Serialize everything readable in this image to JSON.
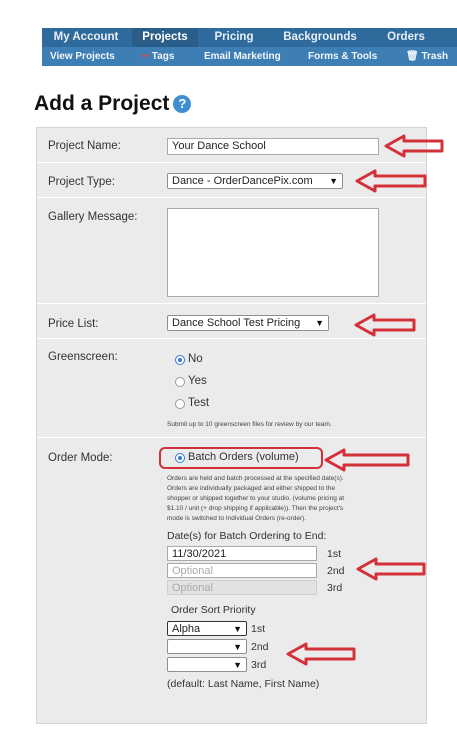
{
  "nav": {
    "tabs": [
      "My Account",
      "Projects",
      "Pricing",
      "Backgrounds",
      "Orders"
    ],
    "active_tab": "Projects",
    "subnav": [
      "View Projects",
      "Tags",
      "Email Marketing",
      "Forms & Tools",
      "Trash"
    ]
  },
  "page": {
    "title": "Add a Project",
    "help_icon": "question-circle-icon"
  },
  "form": {
    "project_name": {
      "label": "Project Name:",
      "value": "Your Dance School"
    },
    "project_type": {
      "label": "Project Type:",
      "selected": "Dance - OrderDancePix.com"
    },
    "gallery_message": {
      "label": "Gallery Message:",
      "value": ""
    },
    "price_list": {
      "label": "Price List:",
      "selected": "Dance School Test Pricing"
    },
    "greenscreen": {
      "label": "Greenscreen:",
      "options": [
        "No",
        "Yes",
        "Test"
      ],
      "selected": "No",
      "note": "Submit up to 10 greenscreen files for review by our team."
    },
    "order_mode": {
      "label": "Order Mode:",
      "selected_option": "Batch Orders (volume)",
      "description": [
        "Orders are held and batch processed at the specified date(s).",
        "Orders are individually packaged and either shipped to the",
        "shopper or shipped together to your studio. (volume pricing at",
        "$1.10 / unit (+ drop shipping if applicable)). Then the project's",
        "mode is switched to Individual Orders (re-order)."
      ],
      "dates_label": "Date(s) for Batch Ordering to End:",
      "dates": [
        {
          "value": "11/30/2021",
          "placeholder": "",
          "ordinal": "1st"
        },
        {
          "value": "",
          "placeholder": "Optional",
          "ordinal": "2nd"
        },
        {
          "value": "",
          "placeholder": "Optional",
          "ordinal": "3rd"
        }
      ],
      "sort_label": "Order Sort Priority",
      "sorts": [
        {
          "selected": "Alpha",
          "ordinal": "1st"
        },
        {
          "selected": "",
          "ordinal": "2nd"
        },
        {
          "selected": "",
          "ordinal": "3rd"
        }
      ],
      "default_note": "(default: Last Name, First Name)"
    }
  },
  "annotation": {
    "color": "#d3303a"
  },
  "colors": {
    "nav_bg": "#2e6a9c",
    "nav_sub_bg": "#3d7fb4",
    "form_bg": "#ebebeb",
    "accent": "#3d8fd1"
  }
}
